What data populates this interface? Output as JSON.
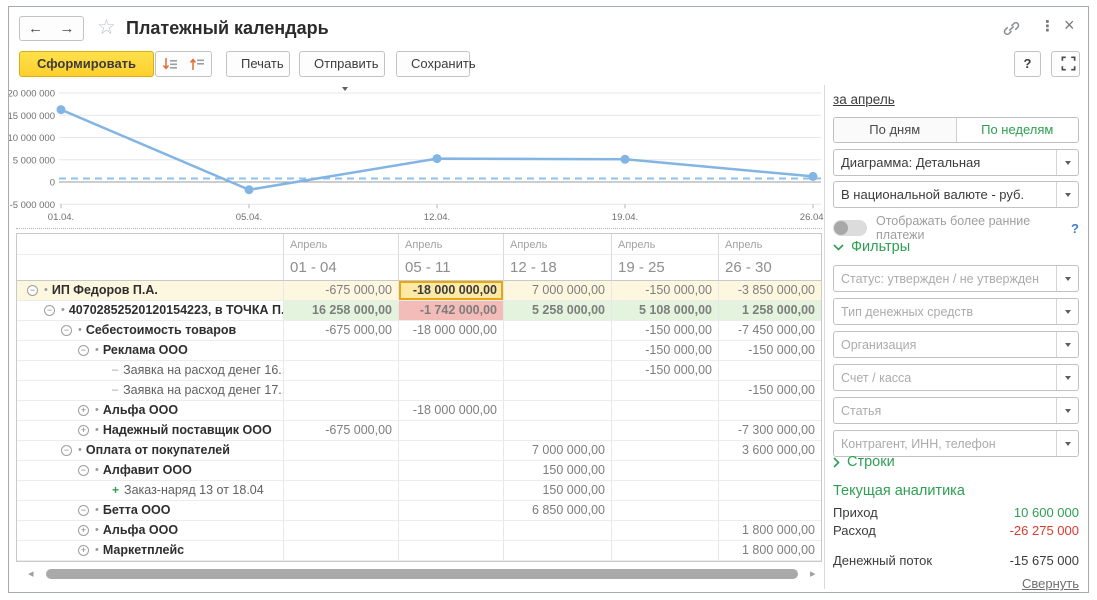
{
  "header": {
    "title": "Платежный календарь"
  },
  "toolbar": {
    "generate": "Сформировать",
    "print": "Печать",
    "send": "Отправить",
    "save": "Сохранить",
    "help": "?"
  },
  "icons": {
    "back": "←",
    "forward": "→",
    "star": "☆",
    "more": "⋮",
    "close": "×",
    "scroll_left": "◂",
    "scroll_right": "▸",
    "dot_marker": "•",
    "dash_marker": "–",
    "plus_marker": "+",
    "expand_minus": "−",
    "expand_plus": "+"
  },
  "colors": {
    "accent_green": "#2d9f52",
    "negative_red": "#e0382c",
    "line_blue": "#82b4e4",
    "selection_border": "#e5a813",
    "row_yellow": "#fdf7e0",
    "cell_green": "#e4f3dd",
    "cell_red": "#f4bcb8"
  },
  "chart_data": {
    "type": "line",
    "x": [
      "01.04.",
      "05.04.",
      "12.04.",
      "19.04.",
      "26.04."
    ],
    "series": [
      {
        "values": [
          16258000,
          -1742000,
          5258000,
          5108000,
          1258000
        ]
      }
    ],
    "threshold": 800000,
    "ylim": [
      -5000000,
      20000000
    ],
    "yticks": [
      20000000,
      15000000,
      10000000,
      5000000,
      0,
      -5000000
    ],
    "ytick_labels": [
      "20 000 000",
      "15 000 000",
      "10 000 000",
      "5 000 000",
      "0",
      "-5 000 000"
    ],
    "grid": true,
    "legend": false
  },
  "table": {
    "columns": [
      {
        "month": "Апрель",
        "range": "01 - 04"
      },
      {
        "month": "Апрель",
        "range": "05 - 11"
      },
      {
        "month": "Апрель",
        "range": "12 - 18"
      },
      {
        "month": "Апрель",
        "range": "19 - 25"
      },
      {
        "month": "Апрель",
        "range": "26 - 30"
      }
    ],
    "rows": [
      {
        "name": "ИП Федоров П.А.",
        "level": 0,
        "expander": "minus",
        "marker": "dot",
        "bold": true,
        "row_bg": "yellow",
        "values": [
          "-675 000,00",
          "-18 000 000,00",
          "7 000 000,00",
          "-150 000,00",
          "-3 850 000,00"
        ],
        "cell_bgs": [
          "yellow",
          "selected",
          "yellow",
          "yellow",
          "yellow"
        ]
      },
      {
        "name": "40702852520120154223, в ТОЧКА П...",
        "level": 1,
        "expander": "minus",
        "marker": "dot",
        "bold": true,
        "bold_values": true,
        "values": [
          "16 258 000,00",
          "-1 742 000,00",
          "5 258 000,00",
          "5 108 000,00",
          "1 258 000,00"
        ],
        "cell_bgs": [
          "green",
          "red",
          "green",
          "green",
          "green"
        ]
      },
      {
        "name": "Себестоимость товаров",
        "level": 2,
        "expander": "minus",
        "marker": "dot",
        "bold": true,
        "values": [
          "-675 000,00",
          "-18 000 000,00",
          "",
          "-150 000,00",
          "-7 450 000,00"
        ]
      },
      {
        "name": "Реклама ООО",
        "level": 3,
        "expander": "minus",
        "marker": "dot",
        "bold": true,
        "values": [
          "",
          "",
          "",
          "-150 000,00",
          "-150 000,00"
        ]
      },
      {
        "name": "Заявка на расход денег 16...",
        "level": 4,
        "expander": null,
        "marker": "dash",
        "bold": false,
        "values": [
          "",
          "",
          "",
          "-150 000,00",
          ""
        ]
      },
      {
        "name": "Заявка на расход денег 17...",
        "level": 4,
        "expander": null,
        "marker": "dash",
        "bold": false,
        "values": [
          "",
          "",
          "",
          "",
          "-150 000,00"
        ]
      },
      {
        "name": "Альфа ООО",
        "level": 3,
        "expander": "plus",
        "marker": "dot",
        "bold": true,
        "values": [
          "",
          "-18 000 000,00",
          "",
          "",
          ""
        ]
      },
      {
        "name": "Надежный поставщик ООО",
        "level": 3,
        "expander": "plus",
        "marker": "dot",
        "bold": true,
        "values": [
          "-675 000,00",
          "",
          "",
          "",
          "-7 300 000,00"
        ]
      },
      {
        "name": "Оплата от покупателей",
        "level": 2,
        "expander": "minus",
        "marker": "dot",
        "bold": true,
        "values": [
          "",
          "",
          "7 000 000,00",
          "",
          "3 600 000,00"
        ]
      },
      {
        "name": "Алфавит ООО",
        "level": 3,
        "expander": "minus",
        "marker": "dot",
        "bold": true,
        "values": [
          "",
          "",
          "150 000,00",
          "",
          ""
        ]
      },
      {
        "name": "Заказ-наряд 13 от 18.04",
        "level": 4,
        "expander": null,
        "marker": "plus",
        "bold": false,
        "values": [
          "",
          "",
          "150 000,00",
          "",
          ""
        ]
      },
      {
        "name": "Бетта ООО",
        "level": 3,
        "expander": "minus",
        "marker": "dot",
        "bold": true,
        "values": [
          "",
          "",
          "6 850 000,00",
          "",
          ""
        ]
      },
      {
        "name": "Альфа ООО",
        "level": 3,
        "expander": "plus",
        "marker": "dot",
        "bold": true,
        "values": [
          "",
          "",
          "",
          "",
          "1 800 000,00"
        ]
      },
      {
        "name": "Маркетплейс",
        "level": 3,
        "expander": "plus",
        "marker": "dot",
        "bold": true,
        "values": [
          "",
          "",
          "",
          "",
          "1 800 000,00"
        ]
      }
    ]
  },
  "sidebar": {
    "period_link": "за апрель",
    "view_tabs": [
      {
        "label": "По дням",
        "active": false
      },
      {
        "label": "По неделям",
        "active": true
      }
    ],
    "diagram_select": "Диаграмма: Детальная",
    "currency_select": "В национальной валюте - руб.",
    "earlier_toggle_label": "Отображать более ранние платежи",
    "earlier_toggle_help": "?",
    "earlier_toggle_on": false,
    "filters_header": "Фильтры",
    "filters": [
      "Статус: утвержден / не утвержден",
      "Тип денежных средств",
      "Организация",
      "Счет / касса",
      "Статья",
      "Контрагент, ИНН, телефон"
    ],
    "rows_header": "Строки",
    "analytics_header": "Текущая аналитика",
    "analytics": [
      {
        "label": "Приход",
        "value": "10 600 000",
        "color": "green"
      },
      {
        "label": "Расход",
        "value": "-26 275 000",
        "color": "red"
      },
      {
        "label": "Денежный поток",
        "value": "-15 675 000",
        "color": "dark",
        "gap": true
      }
    ],
    "collapse_link": "Свернуть"
  }
}
